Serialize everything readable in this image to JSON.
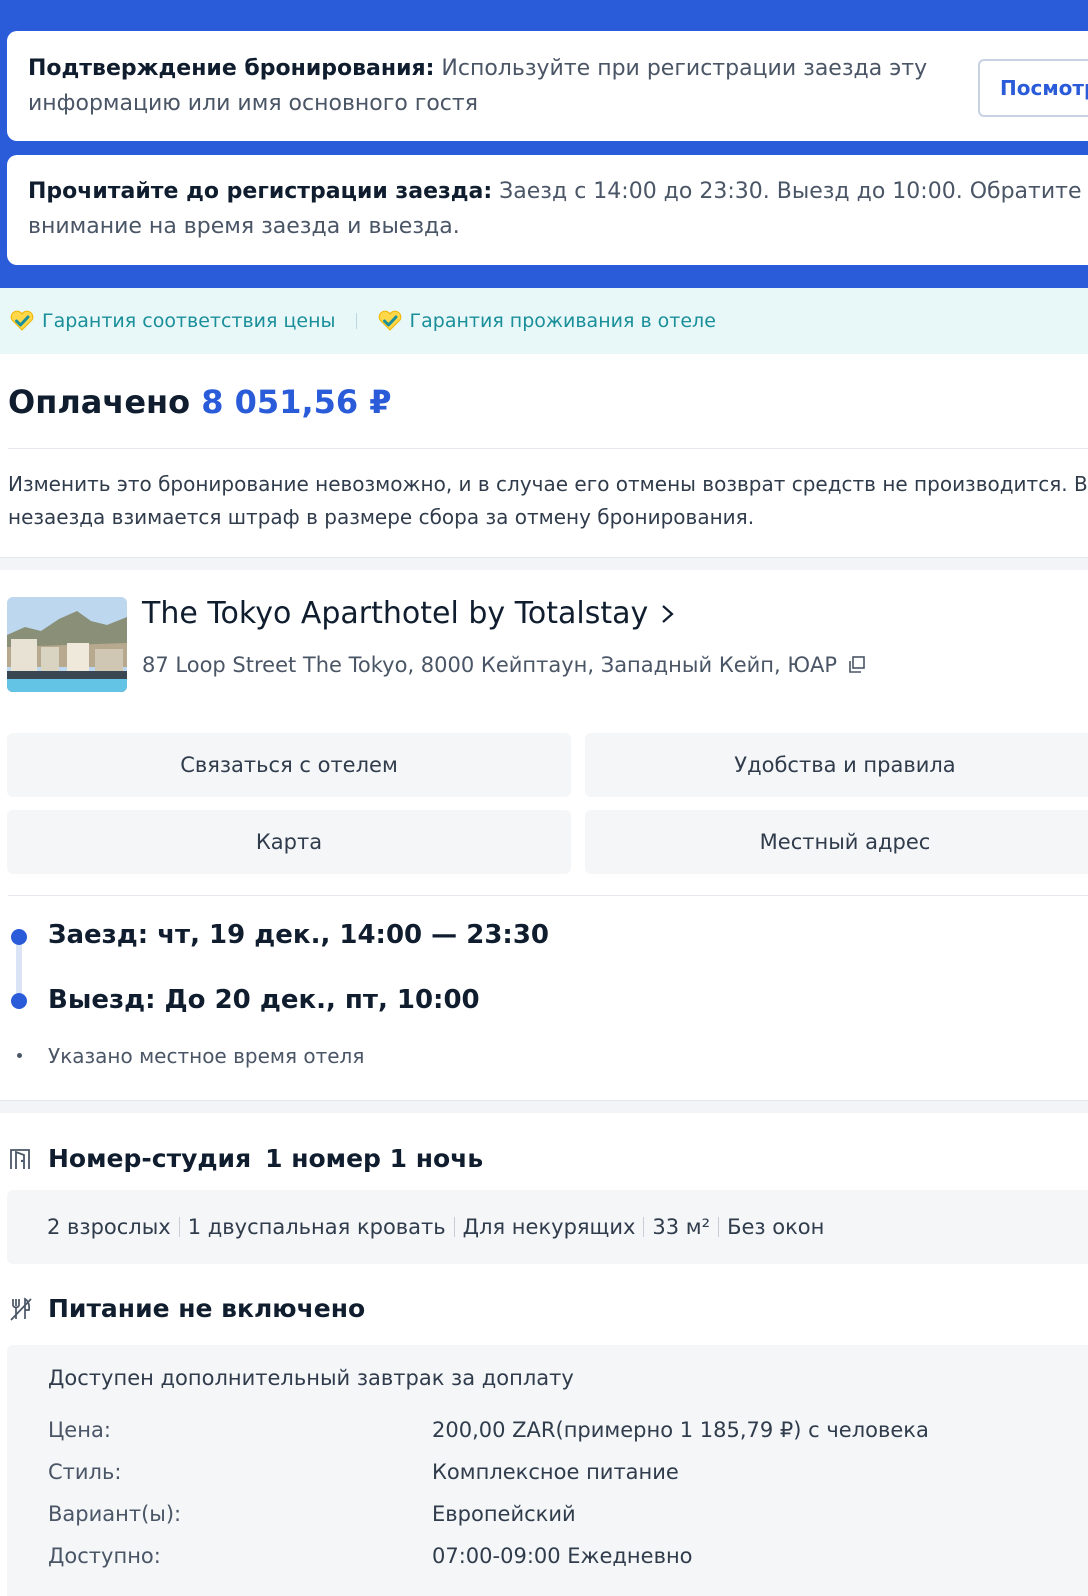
{
  "notices": {
    "confirmation_label": "Подтверждение бронирования:",
    "confirmation_text": " Используйте при регистрации заезда эту информацию или имя основного гостя",
    "view_button": "Посмотр",
    "checkin_label": "Прочитайте до регистрации заезда:",
    "checkin_text": " Заезд с 14:00 до 23:30. Выезд до 10:00. Обратите внимание на время заезда и выезда."
  },
  "guarantees": [
    "Гарантия соответствия цены",
    "Гарантия проживания в отеле"
  ],
  "payment": {
    "label": "Оплачено",
    "amount": "8 051,56 ₽"
  },
  "policy": {
    "line1": "Изменить это бронирование невозможно, и в случае его отмены возврат средств не производится. В слу",
    "line2": "незаезда взимается штраф в размере сбора за отмену бронирования."
  },
  "hotel": {
    "name": "The Tokyo Aparthotel by Totalstay",
    "address": "87 Loop Street The Tokyo, 8000 Кейптаун, Западный Кейп, ЮАР"
  },
  "actions": {
    "contact": "Связаться с отелем",
    "amenities": "Удобства и правила",
    "map": "Карта",
    "local_address": "Местный адрес"
  },
  "stay": {
    "checkin": "Заезд: чт, 19 дек., 14:00 — 23:30",
    "checkout": "Выезд: До 20 дек., пт, 10:00",
    "note": "Указано местное время отеля"
  },
  "room": {
    "type": "Номер-студия",
    "count": "1 номер 1 ночь",
    "features": [
      "2 взрослых",
      "1 двуспальная кровать",
      "Для некурящих",
      "33 м²",
      "Без окон"
    ]
  },
  "meal": {
    "title": "Питание не включено",
    "subtitle": "Доступен дополнительный завтрак за доплату",
    "rows": [
      {
        "key": "Цена:",
        "value": "200,00 ZAR(примерно 1 185,79 ₽) с человека"
      },
      {
        "key": "Стиль:",
        "value": "Комплексное питание"
      },
      {
        "key": "Вариант(ы):",
        "value": "Европейский"
      },
      {
        "key": "Доступно:",
        "value": "07:00-09:00 Ежедневно"
      }
    ]
  },
  "colors": {
    "accent": "#2a5bd9",
    "guarantee_text": "#1a8f9a",
    "guarantee_bg": "#e8f8f8"
  },
  "icons": [
    "heart-check-icon",
    "chevron-right-icon",
    "copy-icon",
    "door-icon",
    "cutlery-off-icon"
  ]
}
